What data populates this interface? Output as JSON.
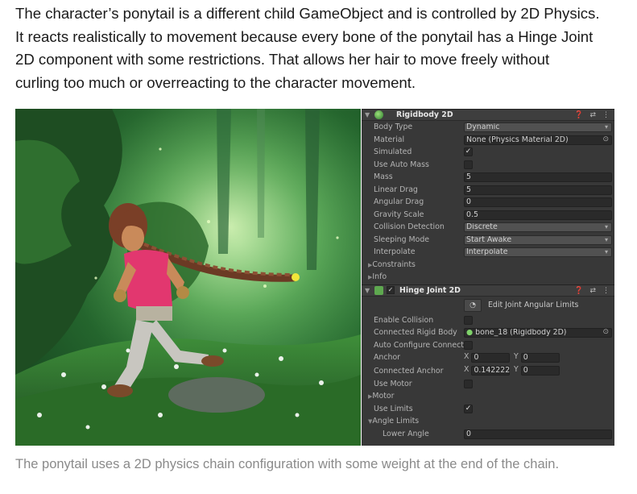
{
  "intro": {
    "lines": [
      "The character’s ponytail is a different child GameObject and is controlled by 2D Physics.",
      "It reacts realistically to movement because every bone of the ponytail has a Hinge Joint",
      "2D component with some restrictions. That allows her hair to move freely without",
      "curling too much or overreacting to the character movement."
    ]
  },
  "caption": "The ponytail uses a 2D physics chain configuration with some weight at the end of the chain.",
  "inspector": {
    "rigidbody": {
      "title": "Rigidbody 2D",
      "body_type": {
        "label": "Body Type",
        "value": "Dynamic"
      },
      "material": {
        "label": "Material",
        "value": "None (Physics Material 2D)"
      },
      "simulated": {
        "label": "Simulated",
        "checked": "✓"
      },
      "use_auto_mass": {
        "label": "Use Auto Mass",
        "checked": ""
      },
      "mass": {
        "label": "Mass",
        "value": "5"
      },
      "linear_drag": {
        "label": "Linear Drag",
        "value": "5"
      },
      "angular_drag": {
        "label": "Angular Drag",
        "value": "0"
      },
      "gravity_scale": {
        "label": "Gravity Scale",
        "value": "0.5"
      },
      "collision_detection": {
        "label": "Collision Detection",
        "value": "Discrete"
      },
      "sleeping_mode": {
        "label": "Sleeping Mode",
        "value": "Start Awake"
      },
      "interpolate": {
        "label": "Interpolate",
        "value": "Interpolate"
      },
      "constraints": "Constraints",
      "info": "Info"
    },
    "hinge": {
      "title": "Hinge Joint 2D",
      "edit_limits": "Edit Joint Angular Limits",
      "enable_collision": {
        "label": "Enable Collision",
        "checked": ""
      },
      "connected_rigid_body": {
        "label": "Connected Rigid Body",
        "value": "bone_18 (Rigidbody 2D)"
      },
      "auto_configure": {
        "label": "Auto Configure Connect",
        "checked": ""
      },
      "anchor": {
        "label": "Anchor",
        "x_key": "X",
        "x": "0",
        "y_key": "Y",
        "y": "0"
      },
      "connected_anchor": {
        "label": "Connected Anchor",
        "x_key": "X",
        "x": "0.142222",
        "y_key": "Y",
        "y": "0"
      },
      "use_motor": {
        "label": "Use Motor",
        "checked": ""
      },
      "motor": "Motor",
      "use_limits": {
        "label": "Use Limits",
        "checked": "✓"
      },
      "angle_limits": "Angle Limits",
      "lower_angle": {
        "label": "Lower Angle",
        "value": "0"
      }
    }
  }
}
